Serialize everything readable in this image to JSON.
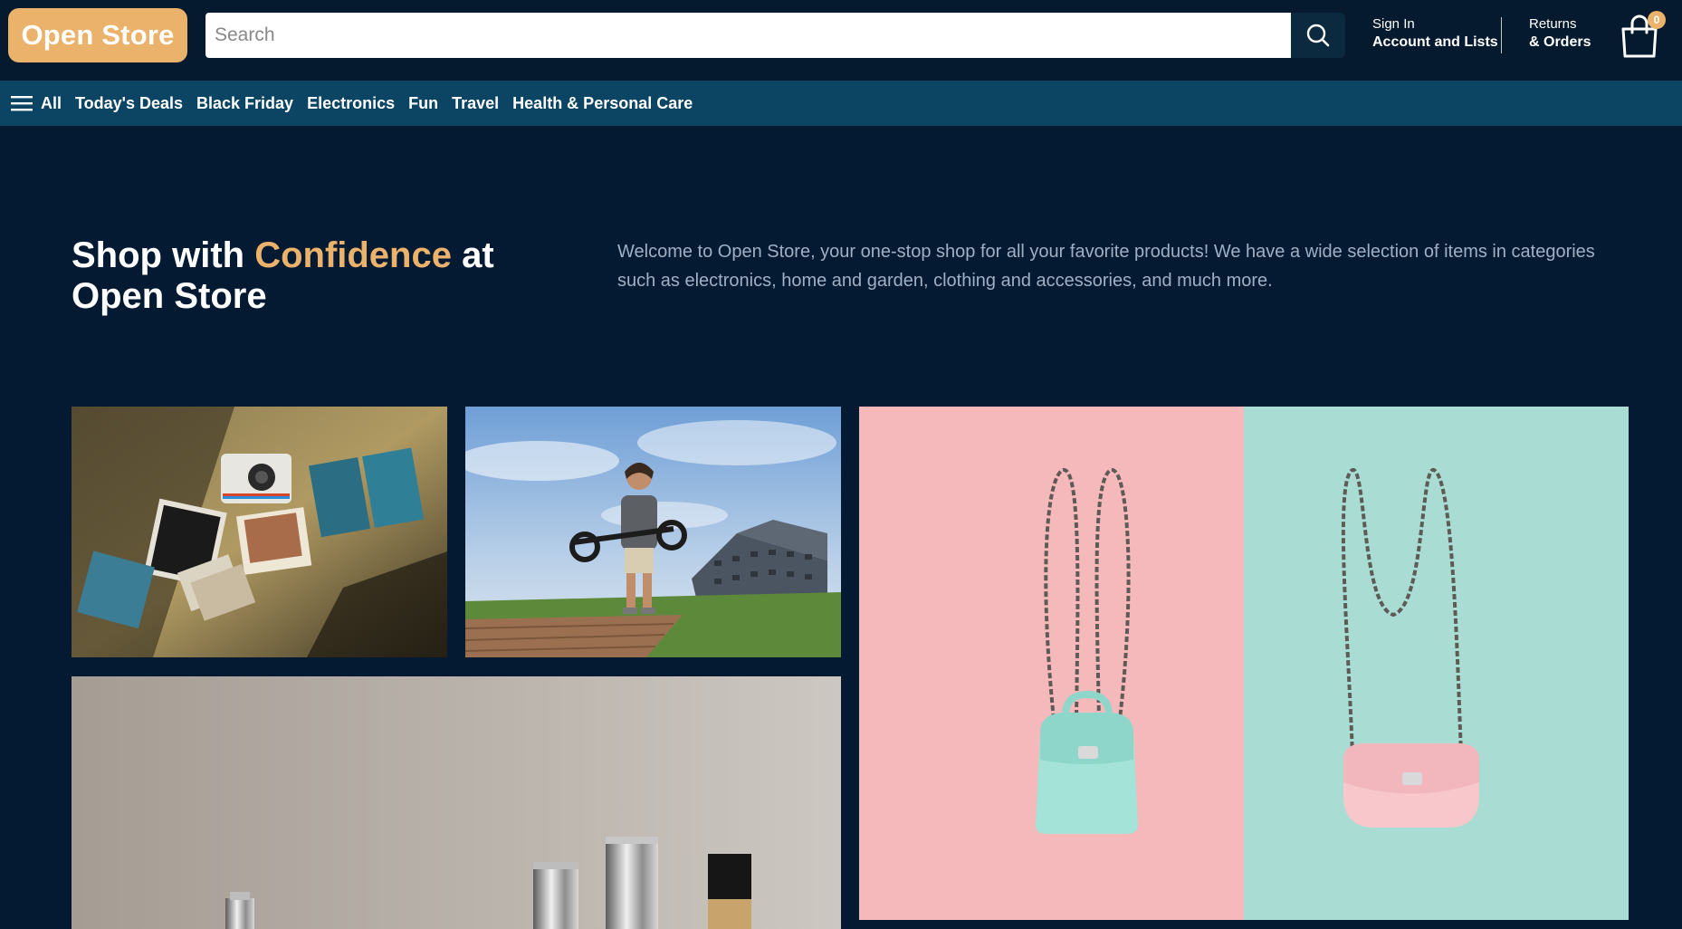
{
  "header": {
    "logo": "Open Store",
    "search_placeholder": "Search",
    "signin_line1": "Sign In",
    "signin_line2": "Account and Lists",
    "returns_line1": "Returns",
    "returns_line2": "& Orders",
    "cart_count": "0"
  },
  "nav": {
    "all_label": "All",
    "items": [
      "Today's Deals",
      "Black Friday",
      "Electronics",
      "Fun",
      "Travel",
      "Health & Personal Care"
    ]
  },
  "hero": {
    "title_part1": "Shop with ",
    "title_accent": "Confidence",
    "title_part2": " at Open Store",
    "description": "Welcome to Open Store, your one-stop shop for all your favorite products! We have a wide selection of items in categories such as electronics, home and garden, clothing and accessories, and much more."
  },
  "colors": {
    "background": "#041a33",
    "header": "#051a2e",
    "nav": "#0b4563",
    "accent": "#eab26b"
  },
  "icons": [
    "search-icon",
    "hamburger-menu-icon",
    "shopping-bag-icon"
  ],
  "images": [
    "polaroid-camera-photo",
    "man-with-scooter-photo",
    "chain-bags-photo",
    "perfume-bottles-photo"
  ]
}
